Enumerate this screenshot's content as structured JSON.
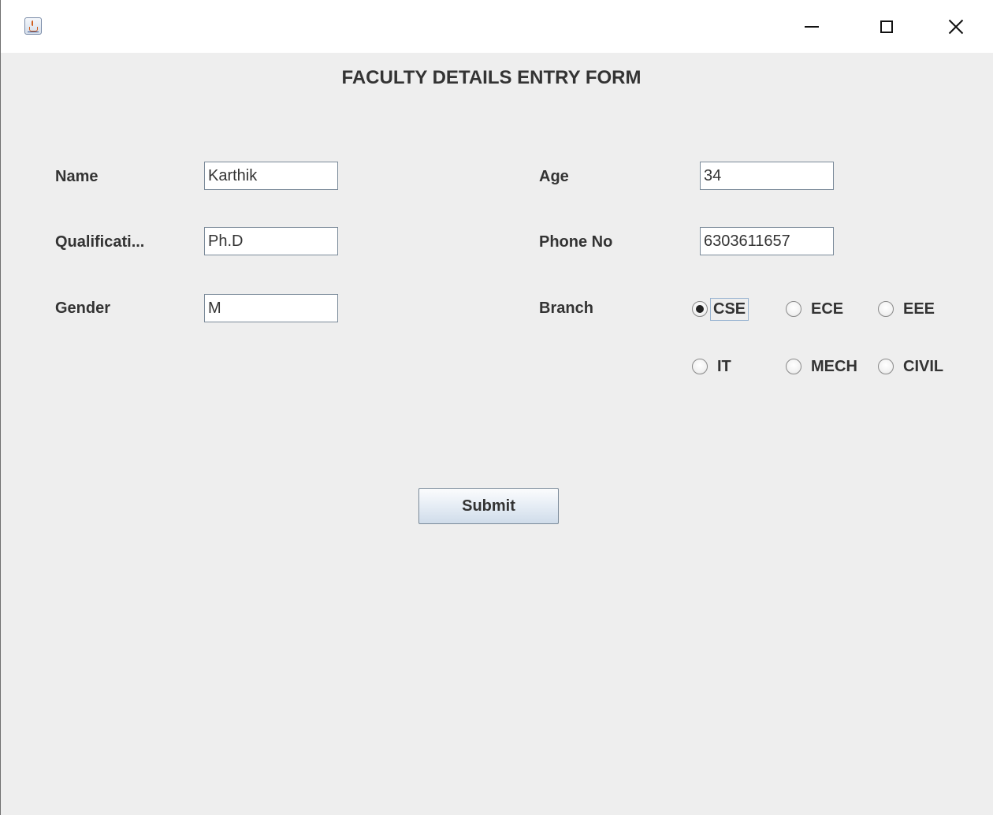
{
  "form": {
    "title": "FACULTY DETAILS ENTRY FORM",
    "fields": {
      "name": {
        "label": "Name",
        "value": "Karthik"
      },
      "qualification": {
        "label": "Qualificati...",
        "value": "Ph.D"
      },
      "gender": {
        "label": "Gender",
        "value": "M"
      },
      "age": {
        "label": "Age",
        "value": "34"
      },
      "phone": {
        "label": "Phone No",
        "value": "6303611657"
      }
    },
    "branch": {
      "label": "Branch",
      "selected": "CSE",
      "options": [
        "CSE",
        "ECE",
        "EEE",
        "IT",
        "MECH",
        "CIVIL"
      ]
    },
    "submit_label": "Submit"
  },
  "titlebar": {
    "icons": [
      "java-app-icon",
      "minimize-icon",
      "maximize-icon",
      "close-icon"
    ]
  }
}
